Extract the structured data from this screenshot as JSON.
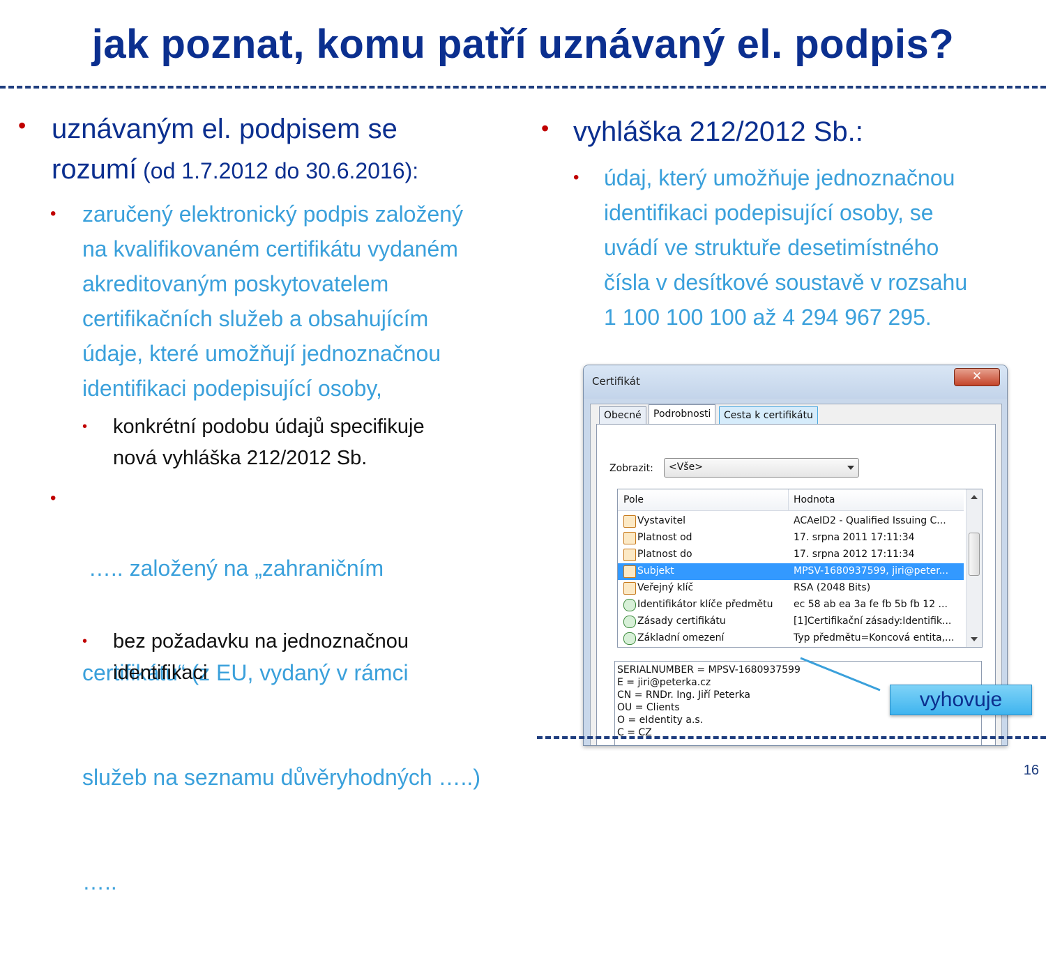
{
  "title": "jak poznat, komu patří uznávaný el. podpis?",
  "page_number": "16",
  "left": {
    "main_line1": "uznávaným el. podpisem se",
    "main_line2_large": "rozumí",
    "main_line2_small": " (od 1.7.2012 do 30.6.2016):",
    "sub1_lines": [
      "zaručený elektronický podpis založený",
      "na kvalifikovaném certifikátu vydaném",
      "akreditovaným poskytovatelem",
      "certifikačních služeb a obsahujícím",
      "údaje, které umožňují jednoznačnou",
      "identifikaci podepisující osoby,"
    ],
    "sub1_child_lines": [
      "konkrétní podobu údajů specifikuje",
      "nová vyhláška 212/2012 Sb."
    ],
    "sub2_lines": [
      " ….. založený na „zahraničním",
      "certifikátu“ (z EU, vydaný v rámci",
      "služeb na seznamu důvěryhodných …..)",
      "….."
    ],
    "sub2_child_lines": [
      "bez požadavku na jednoznačnou",
      "identifikaci"
    ]
  },
  "right": {
    "main": "vyhláška 212/2012 Sb.:",
    "sub_lines": [
      "údaj, který umožňuje jednoznačnou",
      "identifikaci podepisující osoby, se",
      "uvádí ve struktuře desetimístného",
      "čísla v desítkové soustavě v rozsahu",
      "1 100 100 100 až 4 294 967 295."
    ]
  },
  "dialog": {
    "title": "Certifikát",
    "close": "✕",
    "tabs": [
      "Obecné",
      "Podrobnosti",
      "Cesta k certifikátu"
    ],
    "active_tab": "Podrobnosti",
    "show_label": "Zobrazit:",
    "show_value": "<Vše>",
    "col_field": "Pole",
    "col_value": "Hodnota",
    "rows": [
      {
        "field": "Vystavitel",
        "value": "ACAeID2 - Qualified Issuing C..."
      },
      {
        "field": "Platnost od",
        "value": "17. srpna 2011 17:11:34"
      },
      {
        "field": "Platnost do",
        "value": "17. srpna 2012 17:11:34"
      },
      {
        "field": "Subjekt",
        "value": "MPSV-1680937599, jiri@peter..."
      },
      {
        "field": "Veřejný klíč",
        "value": "RSA (2048 Bits)"
      },
      {
        "field": "Identifikátor klíče předmětu",
        "value": "ec 58 ab ea 3a fe fb 5b fb 12 ..."
      },
      {
        "field": "Zásady certifikátu",
        "value": "[1]Certifikační zásady:Identifik..."
      },
      {
        "field": "Základní omezení",
        "value": "Typ předmětu=Koncová entita,..."
      }
    ],
    "selected_row": "Subjekt",
    "detail_lines": [
      "SERIALNUMBER = MPSV-1680937599",
      "E = jiri@peterka.cz",
      "CN = RNDr. Ing. Jiří Peterka",
      "OU = Clients",
      "O = eIdentity a.s.",
      "C = CZ"
    ]
  },
  "callout": "vyhovuje",
  "colors": {
    "title": "#0b2f8f",
    "bullet": "#c00000",
    "level2_text": "#3aa0db",
    "callout_fill": "#3fb4ef"
  }
}
